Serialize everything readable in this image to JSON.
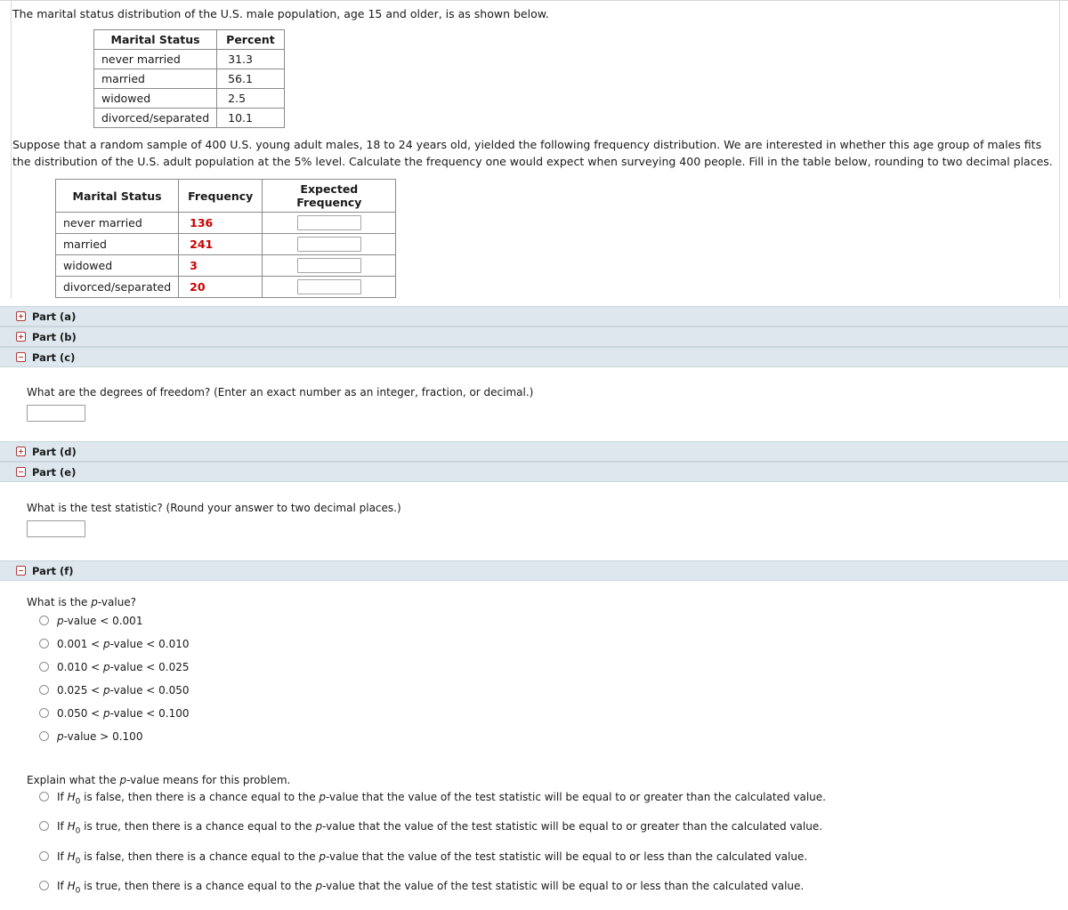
{
  "intro": {
    "sentence": "The marital status distribution of the U.S. male population, age 15 and older, is as shown below."
  },
  "percent_table": {
    "headers": [
      "Marital Status",
      "Percent"
    ],
    "rows": [
      {
        "status": "never married",
        "percent": "31.3"
      },
      {
        "status": "married",
        "percent": "56.1"
      },
      {
        "status": "widowed",
        "percent": "2.5"
      },
      {
        "status": "divorced/separated",
        "percent": "10.1"
      }
    ]
  },
  "prompt": {
    "text": "Suppose that a random sample of 400 U.S. young adult males, 18 to 24 years old, yielded the following frequency distribution. We are interested in whether this age group of males fits the distribution of the U.S. adult population at the 5% level. Calculate the frequency one would expect when surveying 400 people. Fill in the table below, rounding to two decimal places."
  },
  "frequency_table": {
    "headers": [
      "Marital Status",
      "Frequency",
      "Expected Frequency"
    ],
    "rows": [
      {
        "status": "never married",
        "frequency": "136",
        "expected": ""
      },
      {
        "status": "married",
        "frequency": "241",
        "expected": ""
      },
      {
        "status": "widowed",
        "frequency": "3",
        "expected": ""
      },
      {
        "status": "divorced/separated",
        "frequency": "20",
        "expected": ""
      }
    ]
  },
  "parts": {
    "a": {
      "label": "Part (a)",
      "state": "collapsed",
      "toggle_icon": "plus-box-icon"
    },
    "b": {
      "label": "Part (b)",
      "state": "collapsed",
      "toggle_icon": "plus-box-icon"
    },
    "c": {
      "label": "Part (c)",
      "state": "expanded",
      "toggle_icon": "minus-box-icon",
      "question": "What are the degrees of freedom? (Enter an exact number as an integer, fraction, or decimal.)",
      "answer_value": ""
    },
    "d": {
      "label": "Part (d)",
      "state": "collapsed",
      "toggle_icon": "plus-box-icon"
    },
    "e": {
      "label": "Part (e)",
      "state": "expanded",
      "toggle_icon": "minus-box-icon",
      "question": "What is the test statistic? (Round your answer to two decimal places.)",
      "answer_value": ""
    },
    "f": {
      "label": "Part (f)",
      "state": "expanded",
      "toggle_icon": "minus-box-icon",
      "pvalue_question": "What is the p-value?",
      "pvalue_options": [
        "p-value < 0.001",
        "0.001 < p-value < 0.010",
        "0.010 < p-value < 0.025",
        "0.025 < p-value < 0.050",
        "0.050 < p-value < 0.100",
        "p-value > 0.100"
      ],
      "explain_question": "Explain what the p-value means for this problem.",
      "explain_options": [
        "If H0 is false, then there is a chance equal to the p-value that the value of the test statistic will be equal to or greater than the calculated value.",
        "If H0 is true, then there is a chance equal to the p-value that the value of the test statistic will be equal to or greater than the calculated value.",
        "If H0 is false, then there is a chance equal to the p-value that the value of the test statistic will be equal to or less than the calculated value.",
        "If H0 is true, then there is a chance equal to the p-value that the value of the test statistic will be equal to or less than the calculated value."
      ]
    }
  },
  "colors": {
    "part_bar_bg": "#dde7ed",
    "frequency_text": "#cc0000",
    "toggle_border": "#b03a3a"
  }
}
